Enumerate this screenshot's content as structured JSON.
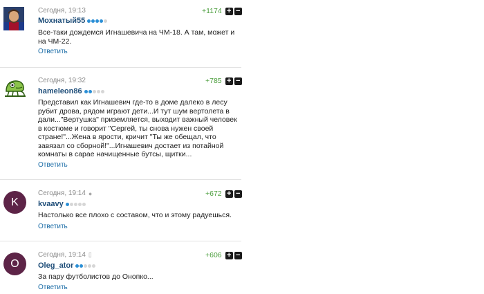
{
  "comments": [
    {
      "time": "Сегодня, 19:13",
      "device": "",
      "username": "Мохнатый55",
      "rating_dots_on": 4,
      "rating_dots_total": 5,
      "score": "+1174",
      "text": "Все-таки дождемся Игнашевича на ЧМ-18. А там, может и на ЧМ-22.",
      "reply_label": "Ответить",
      "avatar_type": "photo"
    },
    {
      "time": "Сегодня, 19:32",
      "device": "",
      "username": "hameleon86",
      "rating_dots_on": 2,
      "rating_dots_total": 5,
      "score": "+785",
      "text": "Представил как Игнашевич где-то в доме далеко в лесу рубит дрова, рядом играют дети...И тут шум вертолета в дали...\"Вертушка\" приземляется, выходит важный человек в костюме и говорит \"Сергей, ты снова нужен своей стране!\"...Жена в ярости, кричит \"Ты же обещал, что завязал со сборной!\"...Игнашевич достает из потайной комнаты в сарае начищенные бутсы, щитки...",
      "reply_label": "Ответить",
      "avatar_type": "chameleon"
    },
    {
      "time": "Сегодня, 19:14",
      "device": "",
      "username": "kvaavy",
      "rating_dots_on": 1,
      "rating_dots_total": 5,
      "score": "+672",
      "text": "Настолько все плохо с составом, что и этому радуешься.",
      "reply_label": "Ответить",
      "avatar_type": "letter",
      "avatar_letter": "K",
      "avatar_color": "#5d2447"
    },
    {
      "time": "Сегодня, 19:14",
      "device": "",
      "username": "Oleg_ator",
      "rating_dots_on": 2,
      "rating_dots_total": 5,
      "score": "+606",
      "text": "За пару футболистов до Онопко...",
      "reply_label": "Ответить",
      "avatar_type": "letter",
      "avatar_letter": "O",
      "avatar_color": "#5d2447"
    }
  ],
  "vote_up": "+",
  "vote_down": "−",
  "colors": {
    "username": "#1f4e79",
    "reply": "#1f6fa8",
    "score": "#4a9d3b",
    "dot_on": "#2b8fd6",
    "dot_off": "#d6d6d6"
  }
}
